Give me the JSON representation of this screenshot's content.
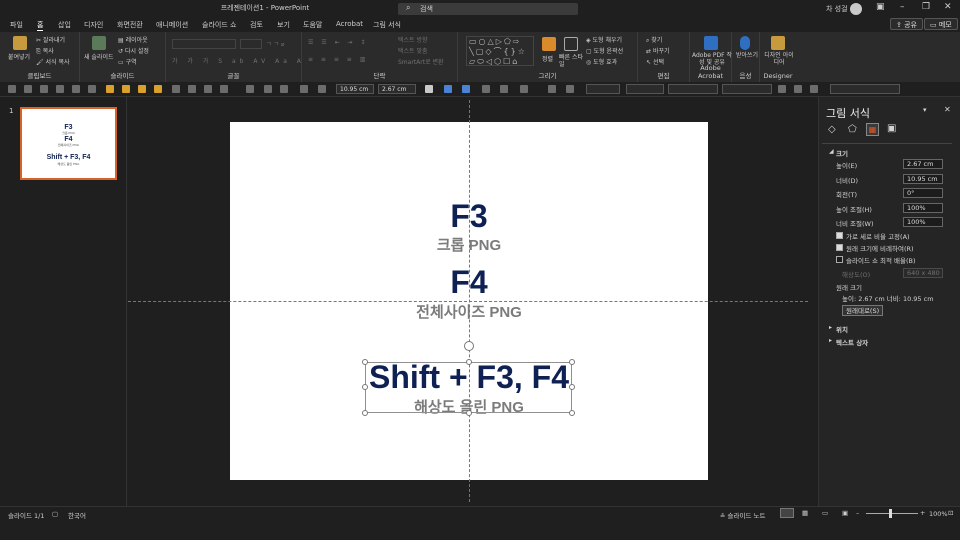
{
  "app": {
    "title": "프레젠테이션1 - PowerPoint",
    "search_placeholder": "검색",
    "user": "차 성걸"
  },
  "tabs": [
    "파일",
    "홈",
    "삽입",
    "디자인",
    "화면전환",
    "애니메이션",
    "슬라이드 쇼",
    "검토",
    "보기",
    "도움말",
    "Acrobat",
    "그림 서식"
  ],
  "active_tab": "홈",
  "share": {
    "share_label": "공유",
    "comment_label": "메모"
  },
  "ribbon": {
    "clipboard": {
      "paste": "붙여넣기",
      "cut": "잘라내기",
      "copy": "복사",
      "format_painter": "서식 복사",
      "label": "클립보드"
    },
    "slides": {
      "new_slide": "새 슬라이드",
      "layout": "레이아웃",
      "reset": "다시 설정",
      "section": "구역",
      "label": "슬라이드"
    },
    "font": {
      "label": "글꼴"
    },
    "paragraph": {
      "text_direction": "텍스트 방향",
      "align_text": "텍스트 맞춤",
      "smartart": "SmartArt로 변환",
      "label": "단락"
    },
    "drawing": {
      "arrange": "정렬",
      "quick_styles": "빠른 스타일",
      "fill": "도형 채우기",
      "outline": "도형 윤곽선",
      "effects": "도형 효과",
      "label": "그리기"
    },
    "editing": {
      "find": "찾기",
      "replace": "바꾸기",
      "select": "선택",
      "label": "편집"
    },
    "acrobat": {
      "create": "Adobe PDF 작성 및 공유",
      "label": "Adobe Acrobat"
    },
    "voice": {
      "dictate": "받아쓰기",
      "label": "음성"
    },
    "designer": {
      "ideas": "디자인 아이디어",
      "label": "Designer"
    }
  },
  "qat": {
    "width": "10.95 cm",
    "height": "2.67 cm"
  },
  "thumbnail": {
    "number": "1",
    "lines": [
      "F3",
      "크롭 PNG",
      "F4",
      "전체사이즈 PNG",
      "Shift + F3, F4",
      "해상도 올린 PNG"
    ]
  },
  "slide": {
    "l1": "F3",
    "l2": "크롭 PNG",
    "l3": "F4",
    "l4": "전체사이즈 PNG",
    "l5": "Shift + F3, F4",
    "l6": "해상도 올린 PNG"
  },
  "pane": {
    "title": "그림 서식",
    "size_section": "크기",
    "height_label": "높이(E)",
    "height": "2.67 cm",
    "width_label": "너비(D)",
    "width": "10.95 cm",
    "rotation_label": "회전(T)",
    "rotation": "0°",
    "scale_h_label": "높이 조절(H)",
    "scale_h": "100%",
    "scale_w_label": "너비 조절(W)",
    "scale_w": "100%",
    "lock_aspect": "가로 세로 비율 고정(A)",
    "relative": "원래 크기에 비례하여(R)",
    "best_scale": "슬라이드 쇼 최적 배율(B)",
    "resolution_label": "해상도(O)",
    "resolution": "640 x 480",
    "original_size": "원래 크기",
    "original_values": "높이:   2.67 cm     너비:   10.95 cm",
    "reset_button": "원래대로(S)",
    "position": "위치",
    "textbox": "텍스트 상자"
  },
  "status": {
    "slide_count": "슬라이드 1/1",
    "language": "한국어",
    "notes": "슬라이드 노트",
    "zoom": "100%"
  }
}
